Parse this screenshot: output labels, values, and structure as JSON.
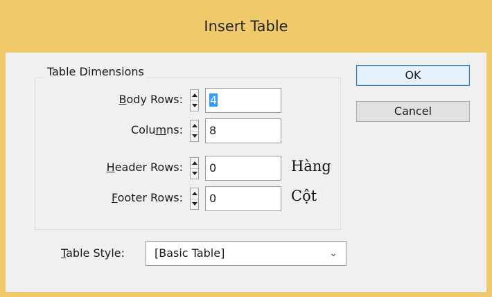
{
  "dialog": {
    "title": "Insert Table",
    "group_title": "Table Dimensions",
    "rows": [
      {
        "label_pre": "",
        "label_key": "B",
        "label_post": "ody Rows:",
        "value": "4",
        "selected": true
      },
      {
        "label_pre": "Colu",
        "label_key": "m",
        "label_post": "ns:",
        "value": "8",
        "selected": false
      },
      {
        "label_pre": "",
        "label_key": "H",
        "label_post": "eader Rows:",
        "value": "0",
        "selected": false
      },
      {
        "label_pre": "",
        "label_key": "F",
        "label_post": "ooter Rows:",
        "value": "0",
        "selected": false
      }
    ],
    "annotations": {
      "header_note": "Hàng",
      "footer_note": "Cột"
    },
    "buttons": {
      "ok": "OK",
      "cancel": "Cancel"
    },
    "table_style": {
      "label_key": "T",
      "label_post": "able Style:",
      "value": "[Basic Table]"
    },
    "colors": {
      "title_bar": "#f0ca6a",
      "client": "#f0f0f0",
      "selection": "#3399ff"
    }
  }
}
